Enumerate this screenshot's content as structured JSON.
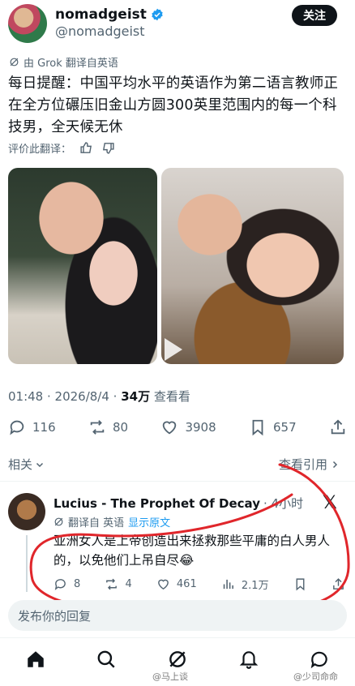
{
  "post": {
    "author_name": "nomadgeist",
    "author_handle": "@nomadgeist",
    "follow_label": "关注",
    "translated_by": "由 Grok 翻译自英语",
    "text": "每日提醒：中国平均水平的英语作为第二语言教师正在全方位碾压旧金山方圆300英里范围内的每一个科技男，全天候无休",
    "rate_translation": "评价此翻译：",
    "timestamp": "01:48 · 2026/8/4 · ",
    "views_count": "34万",
    "views_label": " 查看看",
    "replies": "116",
    "reposts": "80",
    "likes": "3908",
    "bookmarks": "657"
  },
  "related_label": "相关",
  "view_quotes_label": "查看引用",
  "reply": {
    "author_name": "Lucius - The Prophet Of Decay",
    "time": "· 4小时",
    "translated_from": "翻译自 英语",
    "show_original": "显示原文",
    "text": "亚洲女人是上帝创造出来拯救那些平庸的白人男人的，以免他们上吊自尽😂",
    "replies": "8",
    "reposts": "4",
    "likes": "461",
    "views": "2.1万"
  },
  "composer": {
    "placeholder": "发布你的回复"
  },
  "watermarks": {
    "left": "@马上谈",
    "right": "@少司命命"
  },
  "colors": {
    "accent": "#1d9bf0",
    "annotation": "#e0262b",
    "text": "#0f1419",
    "muted": "#536471"
  },
  "icons": [
    "verified-badge-icon",
    "grok-icon",
    "thumbs-up-icon",
    "thumbs-down-icon",
    "reply-icon",
    "repost-icon",
    "like-icon",
    "bookmark-icon",
    "share-icon",
    "chevron-down-icon",
    "chevron-right-icon",
    "x-logo-icon",
    "translate-icon",
    "views-icon",
    "home-icon",
    "search-icon",
    "grok-nav-icon",
    "notifications-icon",
    "messages-icon"
  ]
}
